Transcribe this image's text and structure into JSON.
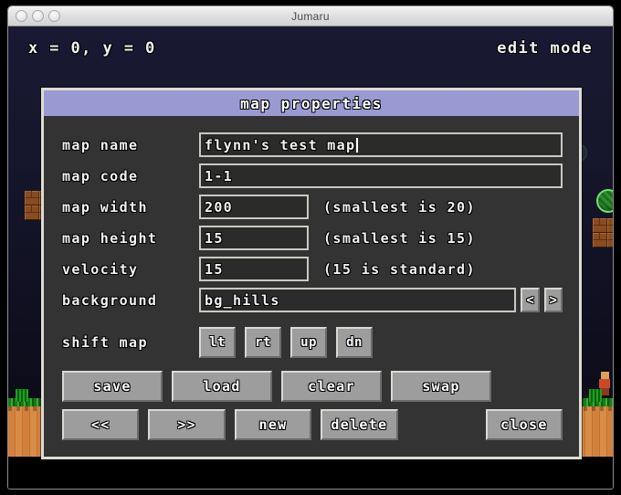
{
  "window": {
    "title": "Jumaru",
    "traffic_lights": [
      "close",
      "minimize",
      "zoom"
    ]
  },
  "hud": {
    "coords": "x = 0, y = 0",
    "mode": "edit mode"
  },
  "dialog": {
    "title": "map properties",
    "header_color": "#9a9ad2",
    "body_color": "#333333",
    "border_color": "#dcdcd4",
    "fields": [
      {
        "label": "map name",
        "value": "flynn's test map",
        "hint": "",
        "width": "wide",
        "caret": true
      },
      {
        "label": "map code",
        "value": "1-1",
        "hint": "",
        "width": "wide",
        "caret": false
      },
      {
        "label": "map width",
        "value": "200",
        "hint": "(smallest is 20)",
        "width": "narrow",
        "caret": false
      },
      {
        "label": "map height",
        "value": "15",
        "hint": "(smallest is 15)",
        "width": "narrow",
        "caret": false
      },
      {
        "label": "velocity",
        "value": "15",
        "hint": "(15 is standard)",
        "width": "narrow",
        "caret": false
      }
    ],
    "background_field": {
      "label": "background",
      "value": "bg_hills",
      "prev_label": "<",
      "next_label": ">"
    },
    "shift_map": {
      "label": "shift map",
      "buttons": [
        "lt",
        "rt",
        "up",
        "dn"
      ]
    },
    "action_row_1": [
      "save",
      "load",
      "clear",
      "swap"
    ],
    "action_row_2": [
      "<<",
      ">>",
      "new",
      "delete"
    ],
    "close_label": "close"
  }
}
